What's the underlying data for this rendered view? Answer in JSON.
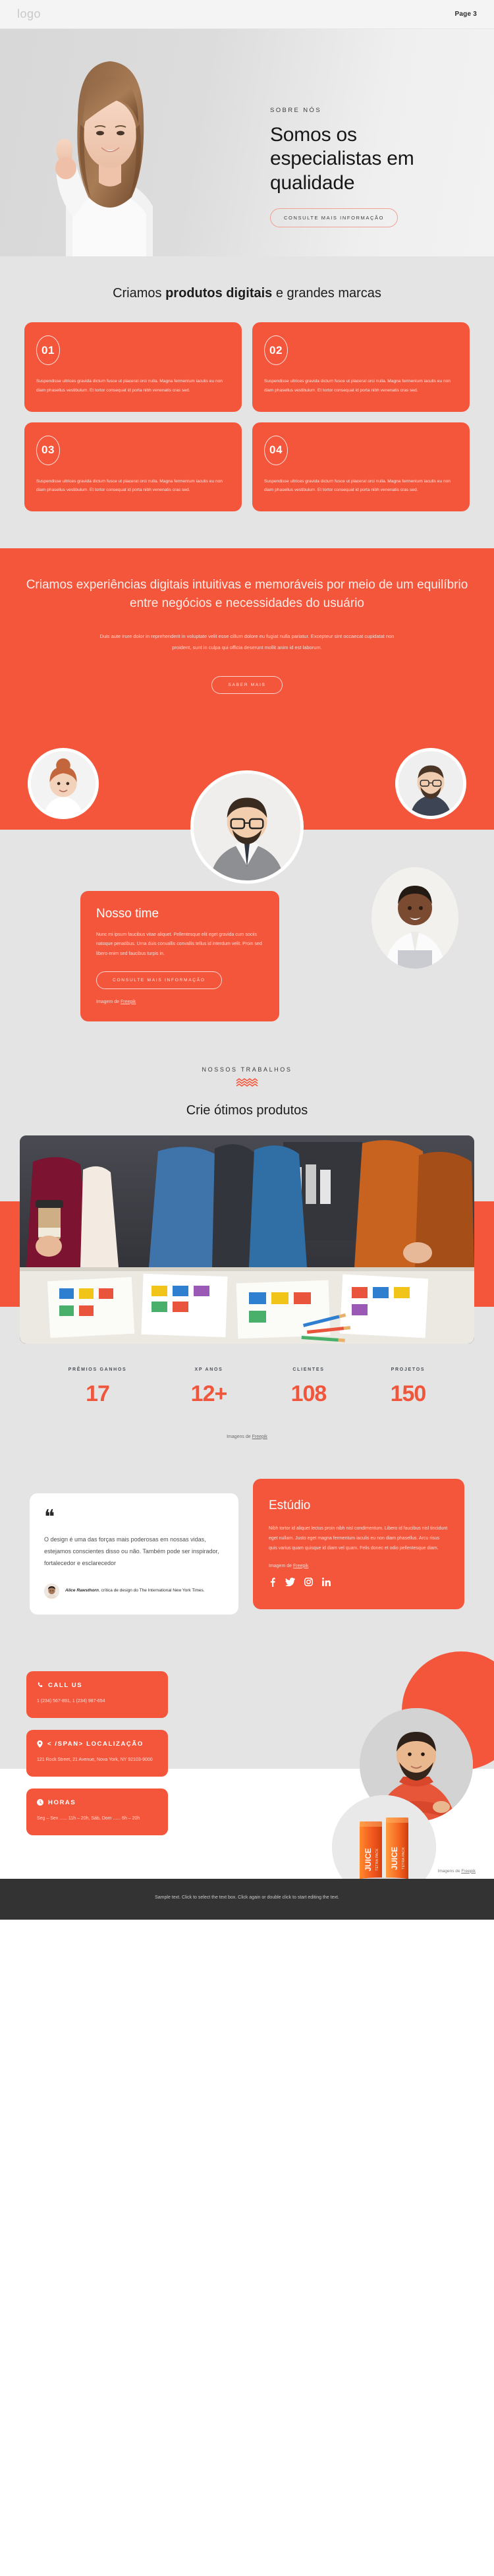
{
  "header": {
    "logo": "logo",
    "page_label": "Page 3"
  },
  "hero": {
    "eyebrow": "SOBRE NÓS",
    "title": "Somos os especialistas em qualidade",
    "cta": "CONSULTE MAIS INFORMAÇÃO"
  },
  "cards_section": {
    "title_prefix": "Criamos ",
    "title_bold": "produtos digitais",
    "title_suffix": " e grandes marcas",
    "body": "Suspendisse ultrices gravida dictum fusce ut placerat orci nulla. Magna fermentum iaculis eu non diam phasellus vestibulum. Et tortor consequat id porta nibh venenatis cras sed.",
    "cards": [
      {
        "number": "01",
        "text": "Suspendisse ultrices gravida dictum fusce ut placerat orci nulla. Magna fermentum iaculis eu non diam phasellus vestibulum. Et tortor consequat id porta nibh venenatis cras sed."
      },
      {
        "number": "02",
        "text": "Suspendisse ultrices gravida dictum fusce ut placerat orci nulla. Magna fermentum iaculis eu non diam phasellus vestibulum. Et tortor consequat id porta nibh venenatis cras sed."
      },
      {
        "number": "03",
        "text": "Suspendisse ultrices gravida dictum fusce ut placerat orci nulla. Magna fermentum iaculis eu non diam phasellus vestibulum. Et tortor consequat id porta nibh venenatis cras sed."
      },
      {
        "number": "04",
        "text": "Suspendisse ultrices gravida dictum fusce ut placerat orci nulla. Magna fermentum iaculis eu non diam phasellus vestibulum. Et tortor consequat id porta nibh venenatis cras sed."
      }
    ]
  },
  "statement": {
    "title": "Criamos experiências digitais intuitivas e memoráveis por meio de um equilíbrio entre negócios e necessidades do usuário",
    "body": "Duis aute irure dolor in reprehenderit in voluptate velit esse cillum dolore eu fugiat nulla pariatur. Excepteur sint occaecat cupidatat non proident, sunt in culpa qui officia deserunt mollit anim id est laborum.",
    "cta": "SABER MAIS"
  },
  "team": {
    "title": "Nosso time",
    "body": "Nunc mi ipsum faucibus vitae aliquet. Pellentesque elit eget gravida cum sociis natoque penatibus. Urna duis convallis convallis tellus id interdum velit. Proin sed libero enim sed faucibus turpis in.",
    "cta": "CONSULTE MAIS INFORMAÇÃO",
    "credit_prefix": "Imagem de ",
    "credit_link": "Freepik"
  },
  "works": {
    "kicker": "NOSSOS TRABALHOS",
    "title": "Crie ótimos produtos"
  },
  "stats": {
    "items": [
      {
        "label": "PRÊMIOS GANHOS",
        "value": "17"
      },
      {
        "label": "XP ANOS",
        "value": "12+"
      },
      {
        "label": "CLIENTES",
        "value": "108"
      },
      {
        "label": "PROJETOS",
        "value": "150"
      }
    ],
    "credit_prefix": "Imagens de ",
    "credit_link": "Freepik"
  },
  "quote": {
    "mark": "❝",
    "text": "O design é uma das forças mais poderosas em nossas vidas, estejamos conscientes disso ou não. Também pode ser inspirador, fortalecedor e esclarecedor",
    "author_name": "Alice Rawsthorn",
    "author_role": ", crítica de design do The International New York Times."
  },
  "studio": {
    "title": "Estúdio",
    "body": "Nibh tortor id aliquet lectus proin nibh nisl condimentum. Libero id faucibus nisl tincidunt eget nullam. Justo eget magna fermentum iaculis eu non diam phasellus. Arcu risus quis varius quam quisque id diam vel quam. Felis donec et odio pellentesque diam.",
    "credit_prefix": "Imagem de ",
    "credit_link": "Freepik",
    "socials": [
      "facebook-icon",
      "twitter-icon",
      "instagram-icon",
      "linkedin-icon"
    ]
  },
  "contact": {
    "cards": [
      {
        "icon": "phone-icon",
        "title": "CALL US",
        "body": "1 (234) 567-891, 1 (234) 987-654"
      },
      {
        "icon": "map-pin-icon",
        "title": "< /SPAN> LOCALIZAÇÃO",
        "body": "121 Rock Street, 21 Avenue, Nova York, NY 92103-9000"
      },
      {
        "icon": "clock-icon",
        "title": "HORAS",
        "body": "Seg – Sex ...... 11h – 20h, Sáb, Dom ...... 6h – 20h"
      }
    ],
    "credit_prefix": "Imagens de ",
    "credit_link": "Freepik"
  },
  "footer": {
    "text": "Sample text. Click to select the text box. Click again or double click to start editing the text."
  },
  "colors": {
    "accent": "#F4563C",
    "page_bg": "#E4E4E4",
    "footer_bg": "#333333",
    "stat_number": "#F0563C"
  }
}
